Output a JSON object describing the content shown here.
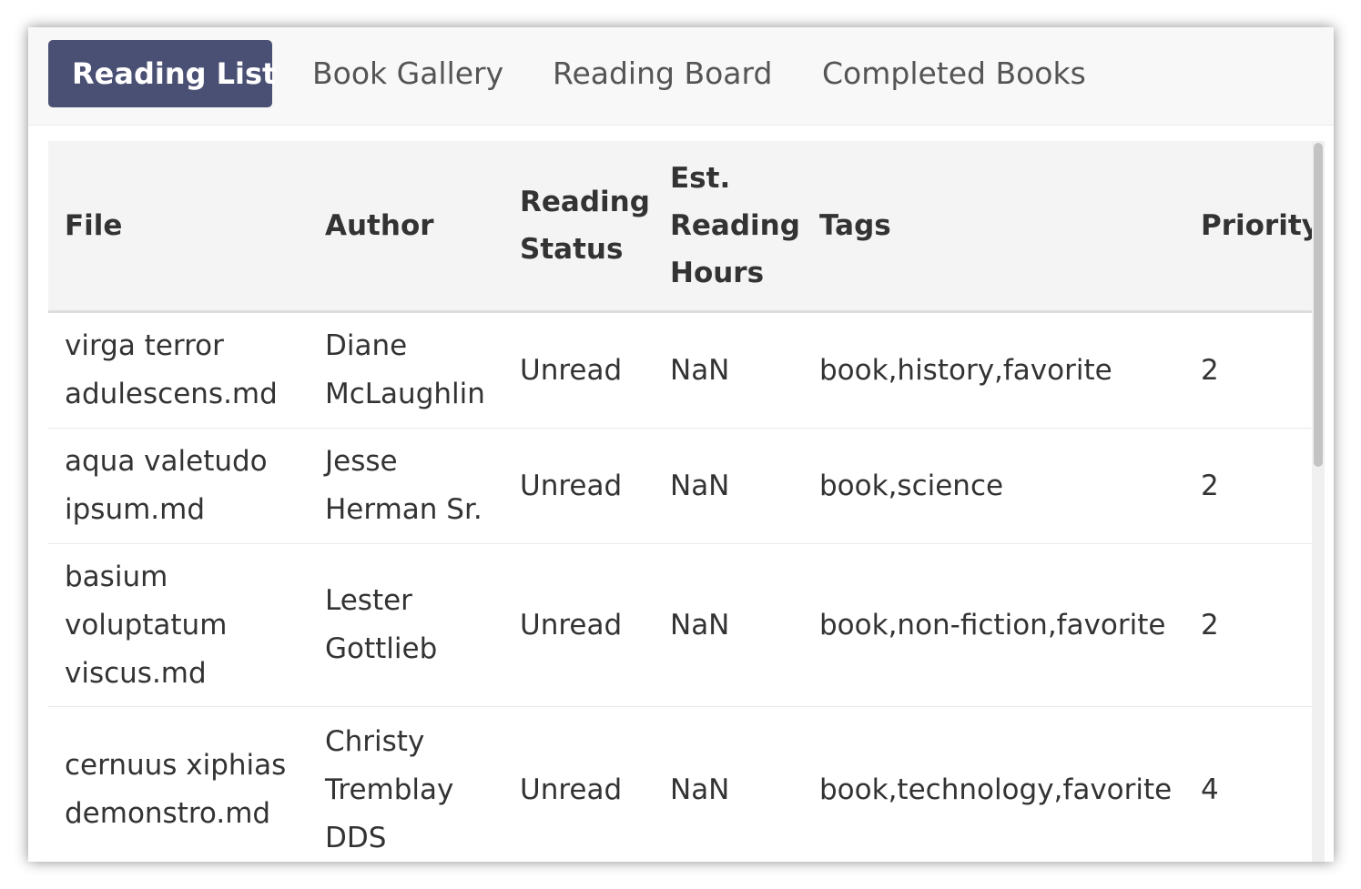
{
  "tabs": [
    {
      "label": "Reading List",
      "active": true
    },
    {
      "label": "Book Gallery",
      "active": false
    },
    {
      "label": "Reading Board",
      "active": false
    },
    {
      "label": "Completed Books",
      "active": false
    }
  ],
  "table": {
    "headers": {
      "file": "File",
      "author": "Author",
      "status": "Reading Status",
      "hours": "Est. Reading Hours",
      "tags": "Tags",
      "priority": "Priority"
    },
    "rows": [
      {
        "file": "virga terror adulescens.md",
        "author": "Diane McLaughlin",
        "status": "Unread",
        "hours": "NaN",
        "tags": "book,history,favorite",
        "priority": "2"
      },
      {
        "file": "aqua valetudo ipsum.md",
        "author": "Jesse Herman Sr.",
        "status": "Unread",
        "hours": "NaN",
        "tags": "book,science",
        "priority": "2"
      },
      {
        "file": "basium voluptatum viscus.md",
        "author": "Lester Gottlieb",
        "status": "Unread",
        "hours": "NaN",
        "tags": "book,non-fiction,favorite",
        "priority": "2"
      },
      {
        "file": "cernuus xiphias demonstro.md",
        "author": "Christy Tremblay DDS",
        "status": "Unread",
        "hours": "NaN",
        "tags": "book,technology,favorite",
        "priority": "4"
      }
    ]
  },
  "colors": {
    "active_tab_bg": "#4a5073",
    "header_bg": "#f4f4f4"
  }
}
